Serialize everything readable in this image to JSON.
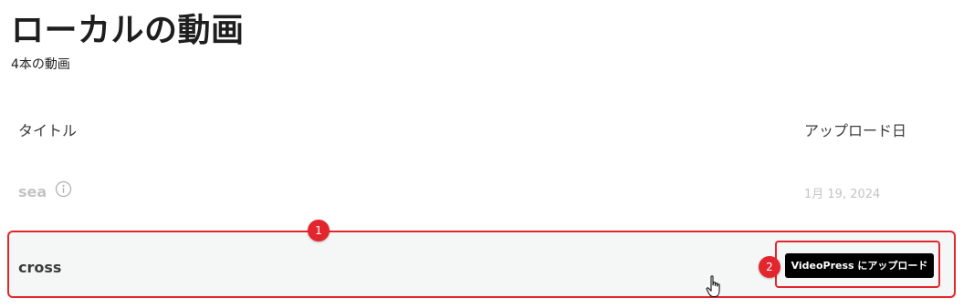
{
  "header": {
    "title": "ローカルの動画",
    "count": "4本の動画"
  },
  "table": {
    "columns": {
      "title": "タイトル",
      "upload_date": "アップロード日"
    },
    "rows": [
      {
        "title": "sea",
        "date": "1月 19, 2024"
      },
      {
        "title": "cross",
        "action_label": "VideoPress にアップロード"
      }
    ]
  },
  "annotations": {
    "badge_1": "1",
    "badge_2": "2",
    "color": "#e3262e"
  },
  "icons": {
    "info": "info-icon",
    "cursor": "hand-pointer-icon"
  }
}
